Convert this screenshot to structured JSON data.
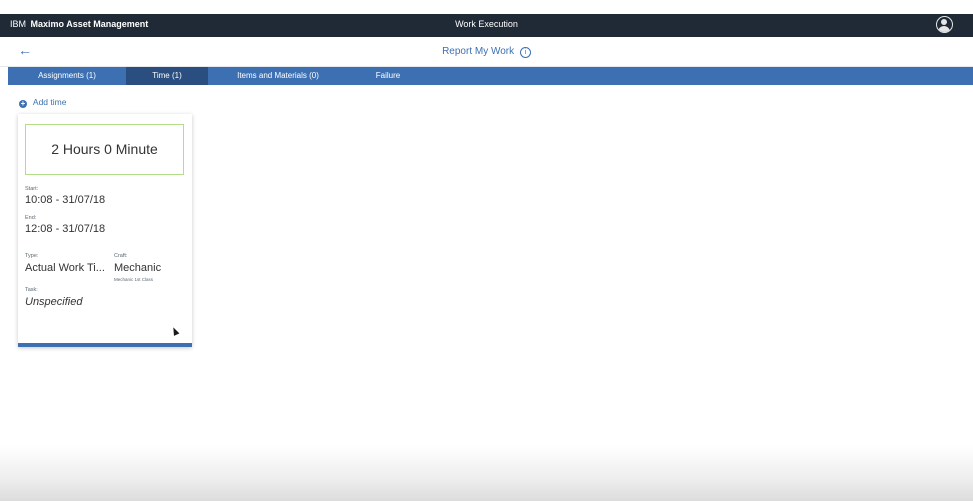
{
  "header": {
    "vendor": "IBM",
    "product": "Maximo Asset Management",
    "app_name": "Work Execution",
    "user_icon": "user-avatar-icon"
  },
  "subheader": {
    "back_icon": "←",
    "title": "Report My Work",
    "info_icon": "i"
  },
  "tabs": [
    {
      "label": "Assignments (1)",
      "active": false
    },
    {
      "label": "Time (1)",
      "active": true
    },
    {
      "label": "Items and Materials (0)",
      "active": false
    },
    {
      "label": "Failure",
      "active": false
    }
  ],
  "add_time": {
    "label": "Add time",
    "icon": "+"
  },
  "time_card": {
    "duration": "2 Hours 0 Minute",
    "start_label": "Start:",
    "start_value": "10:08 - 31/07/18",
    "end_label": "End:",
    "end_value": "12:08 - 31/07/18",
    "type_label": "Type:",
    "type_value": "Actual Work Ti...",
    "craft_label": "Craft:",
    "craft_value": "Mechanic",
    "craft_detail": "Mechanic 1st Class",
    "task_label": "Task:",
    "task_value": "Unspecified"
  },
  "colors": {
    "topbar": "#1f2a36",
    "tabbar": "#3d70b2",
    "tab_active": "#2a4e80",
    "duration_border": "#b3dd89",
    "link": "#3d70b2"
  }
}
